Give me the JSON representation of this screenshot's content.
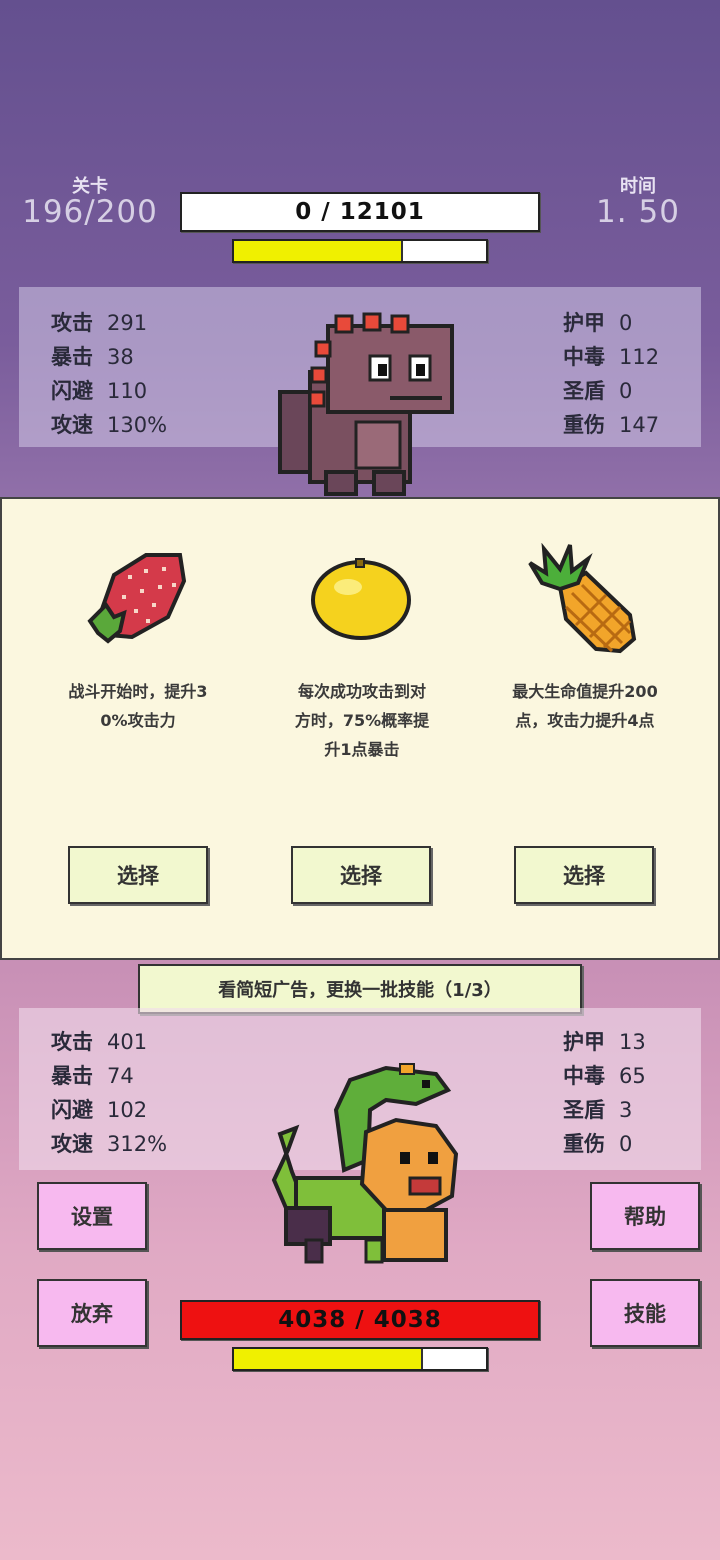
{
  "hud": {
    "level_label": "关卡",
    "level_value": "196/200",
    "time_label": "时间",
    "time_value": "1. 50"
  },
  "enemy": {
    "hp_text": "0  /  12101",
    "hp_fraction": 0.0,
    "energy_fraction": 0.67,
    "stats_left": [
      {
        "label": "攻击",
        "value": "291"
      },
      {
        "label": "暴击",
        "value": "38"
      },
      {
        "label": "闪避",
        "value": "110"
      },
      {
        "label": "攻速",
        "value": "130%"
      }
    ],
    "stats_right": [
      {
        "label": "护甲",
        "value": "0"
      },
      {
        "label": "中毒",
        "value": "112"
      },
      {
        "label": "圣盾",
        "value": "0"
      },
      {
        "label": "重伤",
        "value": "147"
      }
    ]
  },
  "cards": [
    {
      "icon": "strawberry-icon",
      "desc": "战斗开始时，提升3\n0%攻击力",
      "button": "选择"
    },
    {
      "icon": "lemon-icon",
      "desc": "每次成功攻击到对\n方时，75%概率提\n升1点暴击",
      "button": "选择"
    },
    {
      "icon": "pineapple-icon",
      "desc": "最大生命值提升200\n点，攻击力提升4点",
      "button": "选择"
    }
  ],
  "reroll_label": "看简短广告，更换一批技能（1/3）",
  "player": {
    "hp_text": "4038  /  4038",
    "hp_fraction": 1.0,
    "energy_fraction": 0.75,
    "stats_left": [
      {
        "label": "攻击",
        "value": "401"
      },
      {
        "label": "暴击",
        "value": "74"
      },
      {
        "label": "闪避",
        "value": "102"
      },
      {
        "label": "攻速",
        "value": "312%"
      }
    ],
    "stats_right": [
      {
        "label": "护甲",
        "value": "13"
      },
      {
        "label": "中毒",
        "value": "65"
      },
      {
        "label": "圣盾",
        "value": "3"
      },
      {
        "label": "重伤",
        "value": "0"
      }
    ]
  },
  "buttons": {
    "settings": "设置",
    "help": "帮助",
    "give_up": "放弃",
    "skills": "技能"
  },
  "colors": {
    "hp_red": "#ee1111",
    "energy_yellow": "#f0f000",
    "card_bg": "#fbf7df",
    "select_bg": "#f2f8cf",
    "side_btn_bg": "#f7b9ef"
  }
}
